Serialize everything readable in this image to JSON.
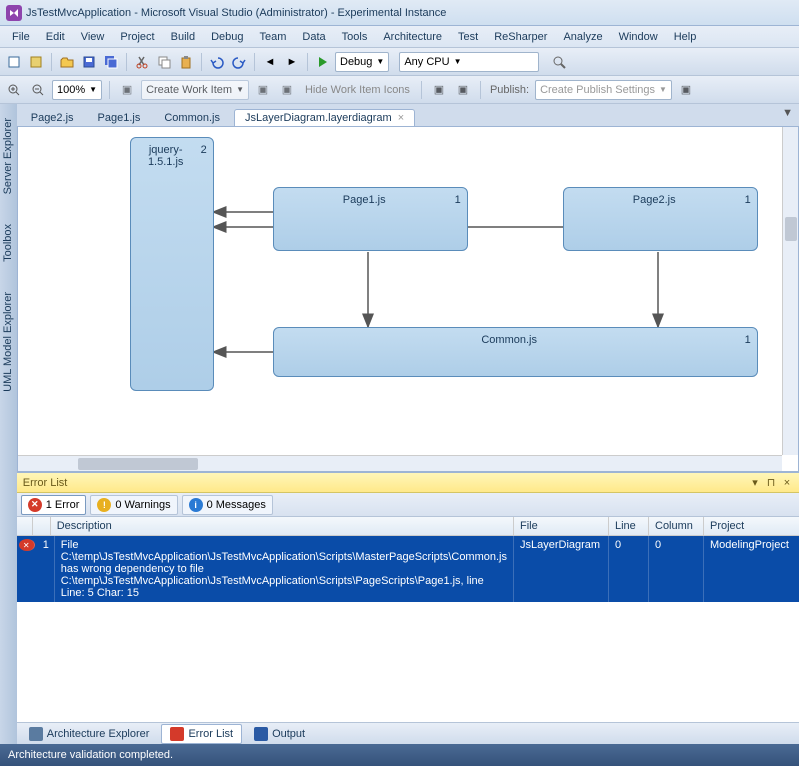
{
  "titlebar": {
    "title": "JsTestMvcApplication - Microsoft Visual Studio (Administrator) - Experimental Instance"
  },
  "menu": [
    "File",
    "Edit",
    "View",
    "Project",
    "Build",
    "Debug",
    "Team",
    "Data",
    "Tools",
    "Architecture",
    "Test",
    "ReSharper",
    "Analyze",
    "Window",
    "Help"
  ],
  "toolbar1": {
    "config_label": "Debug",
    "platform_label": "Any CPU"
  },
  "toolbar2": {
    "zoom": "100%",
    "create_wi": "Create Work Item",
    "hide_wi": "Hide Work Item Icons",
    "publish": "Publish:",
    "publish_settings": "Create Publish Settings"
  },
  "sidebar": {
    "server_explorer": "Server Explorer",
    "toolbox": "Toolbox",
    "uml_model_explorer": "UML Model Explorer"
  },
  "tabs": [
    {
      "label": "Page2.js",
      "active": false
    },
    {
      "label": "Page1.js",
      "active": false
    },
    {
      "label": "Common.js",
      "active": false
    },
    {
      "label": "JsLayerDiagram.layerdiagram",
      "active": true
    }
  ],
  "diagram": {
    "jquery": {
      "label": "jquery-1.5.1.js",
      "count": "2"
    },
    "page1": {
      "label": "Page1.js",
      "count": "1"
    },
    "page2": {
      "label": "Page2.js",
      "count": "1"
    },
    "common": {
      "label": "Common.js",
      "count": "1"
    }
  },
  "errorlist": {
    "title": "Error List",
    "errors_btn": "1 Error",
    "warnings_btn": "0 Warnings",
    "messages_btn": "0 Messages",
    "columns": {
      "desc": "Description",
      "file": "File",
      "line": "Line",
      "col": "Column",
      "proj": "Project"
    },
    "row1": {
      "num": "1",
      "desc": "File C:\\temp\\JsTestMvcApplication\\JsTestMvcApplication\\Scripts\\MasterPageScripts\\Common.js has wrong dependency to file C:\\temp\\JsTestMvcApplication\\JsTestMvcApplication\\Scripts\\PageScripts\\Page1.js, line Line: 5 Char: 15",
      "file": "JsLayerDiagram",
      "line": "0",
      "col": "0",
      "proj": "ModelingProject"
    }
  },
  "bottom_tabs": {
    "arch": "Architecture Explorer",
    "err": "Error List",
    "out": "Output"
  },
  "statusbar": {
    "text": "Architecture validation completed."
  }
}
